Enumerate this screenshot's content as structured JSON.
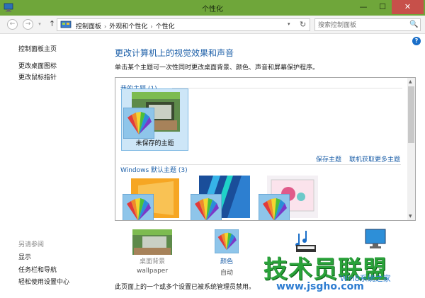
{
  "window": {
    "title": "个性化",
    "min": "—",
    "max": "☐",
    "close": "✕"
  },
  "nav": {
    "back": "←",
    "forward": "→",
    "recent": "▾",
    "up": "↑",
    "breadcrumbs": [
      "控制面板",
      "外观和个性化",
      "个性化"
    ],
    "separator": "›",
    "refresh": "↻",
    "search_placeholder": "搜索控制面板"
  },
  "help": "?",
  "sidebar": {
    "home": "控制面板主页",
    "change_icons": "更改桌面图标",
    "change_pointer": "更改鼠标指针",
    "see_also": "另请参阅",
    "display": "显示",
    "taskbar": "任务栏和导航",
    "ease": "轻松使用设置中心"
  },
  "main": {
    "title": "更改计算机上的视觉效果和声音",
    "desc": "单击某个主题可一次性同时更改桌面背景、颜色、声音和屏幕保护程序。"
  },
  "themes": {
    "my_themes": "我的主题 (1)",
    "unsaved_label": "未保存的主题",
    "save_link": "保存主题",
    "online_link": "联机获取更多主题",
    "windows_default": "Windows 默认主题 (3)"
  },
  "bottom": {
    "background_label": "桌面背景",
    "background_value": "wallpaper",
    "color_label": "颜色",
    "color_value": "自动",
    "footer": "此页面上的一个或多个设置已被系统管理员禁用。"
  },
  "watermark": {
    "big": "技术员联盟",
    "url": "www.jsgho.com",
    "sub": "Win8系统之家"
  },
  "colors": {
    "titlebar": "#6fa63a",
    "accent": "#1c5fa8",
    "selected": "#cde6f7"
  }
}
